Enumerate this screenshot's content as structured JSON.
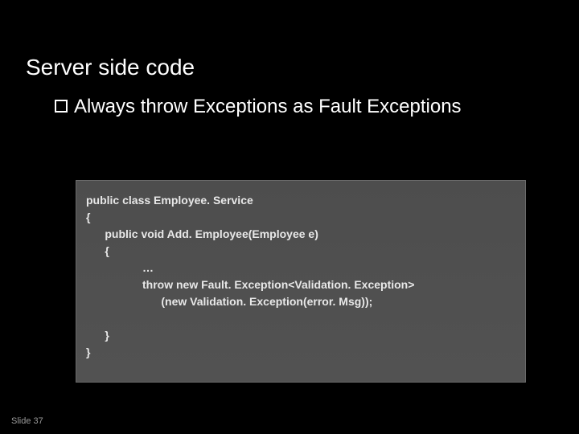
{
  "slide": {
    "title": "Server side code",
    "bullet1": "Always throw Exceptions as Fault Exceptions",
    "code": {
      "l1": "public class Employee. Service",
      "l2": "{",
      "l3": "      public void Add. Employee(Employee e)",
      "l4": "      {",
      "l5": "                  …",
      "l6": "                  throw new Fault. Exception<Validation. Exception>",
      "l7": "                        (new Validation. Exception(error. Msg));",
      "l8": "",
      "l9": "      }",
      "l10": "}"
    },
    "footer": "Slide 37"
  }
}
